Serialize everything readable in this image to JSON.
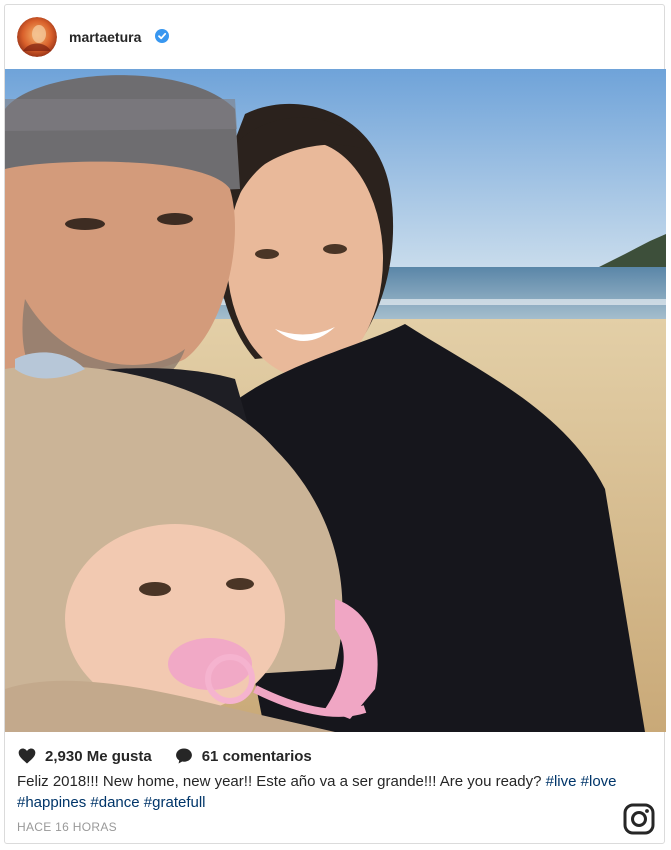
{
  "post": {
    "username": "martaetura",
    "likes": "2,930 Me gusta",
    "comments": "61 comentarios",
    "caption_text": "Feliz 2018!!! New home, new year!! Este año va a ser grande!!! Are you ready?",
    "hashtags": [
      "#live",
      "#love",
      "#happines",
      "#dance",
      "#gratefull"
    ],
    "time": "HACE 16 HORAS"
  },
  "icons": {
    "verified": "verified-badge-icon",
    "heart": "heart-icon",
    "comment": "comment-bubble-icon",
    "brand": "instagram-logo-icon"
  },
  "colors": {
    "verified": "#3897f0",
    "hashtag": "#003569",
    "timestamp": "#999999"
  }
}
